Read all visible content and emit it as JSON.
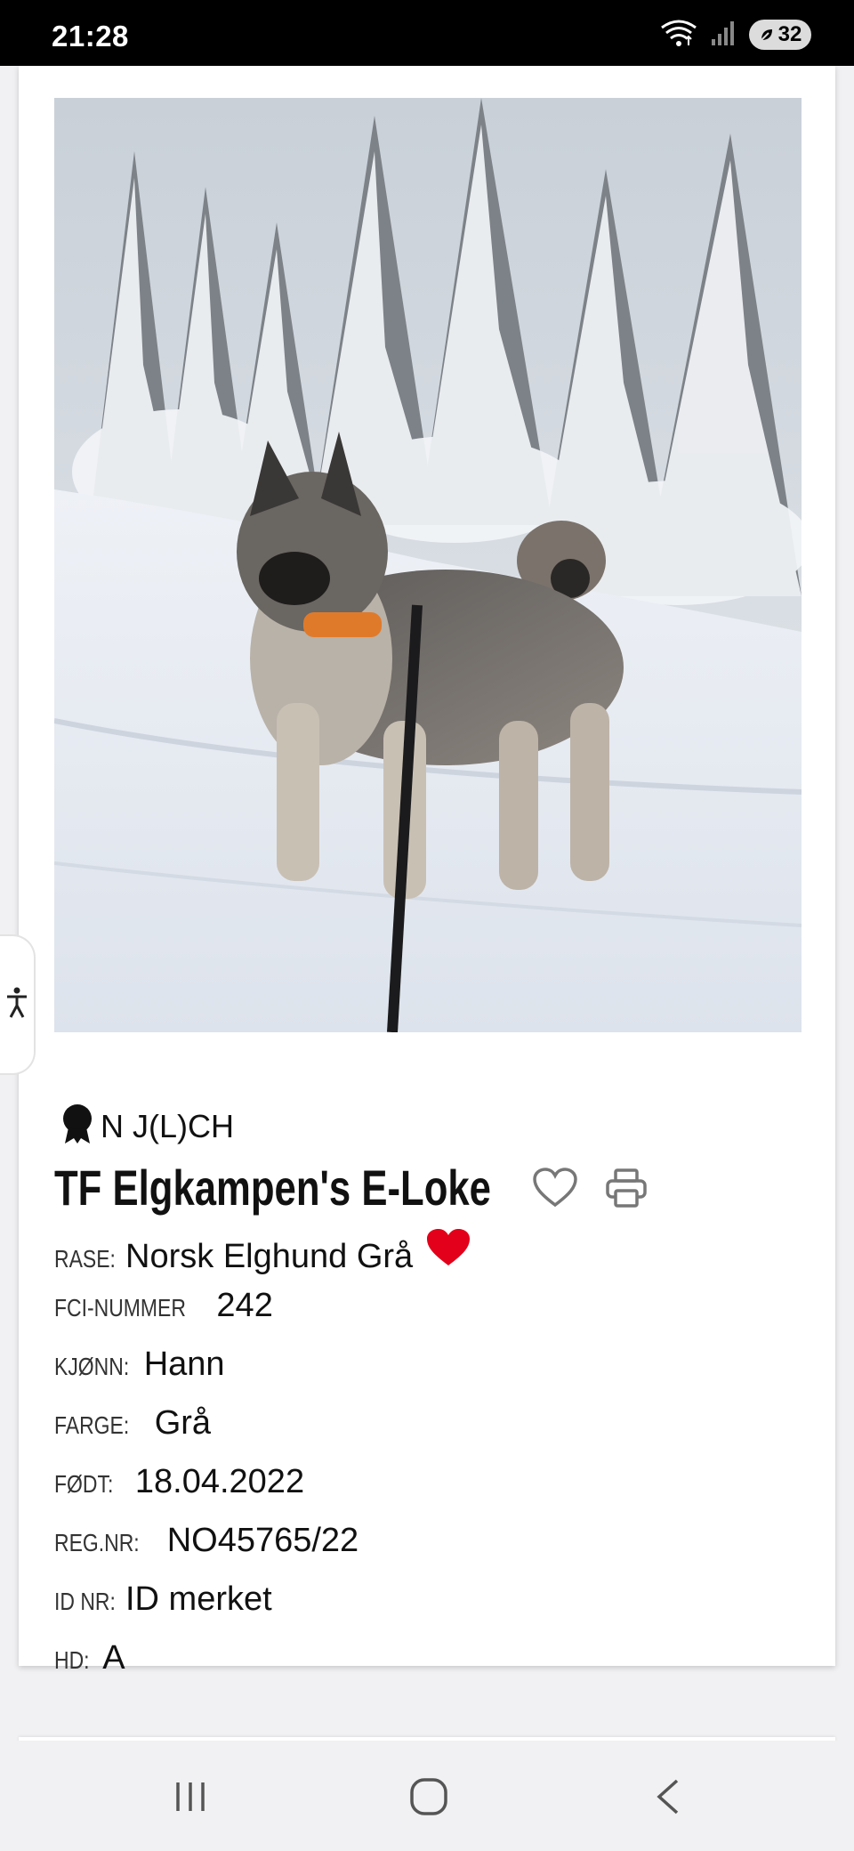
{
  "status_bar": {
    "time": "21:28",
    "battery": "32",
    "icons": [
      "wifi-icon",
      "signal-icon",
      "battery-saver-icon"
    ]
  },
  "dog": {
    "title_badge": "N J(L)CH",
    "name": "TF Elgkampen's E-Loke",
    "fields": [
      {
        "label": "RASE:",
        "value": "Norsk Elghund Grå"
      },
      {
        "label": "FCI-NUMMER",
        "value": "242"
      },
      {
        "label": "KJØNN:",
        "value": "Hann"
      },
      {
        "label": "FARGE:",
        "value": "Grå"
      },
      {
        "label": "FØDT:",
        "value": "18.04.2022"
      },
      {
        "label": "REG.NR:",
        "value": "NO45765/22"
      },
      {
        "label": "ID NR:",
        "value": "ID merket"
      },
      {
        "label": "HD:",
        "value": "A"
      }
    ]
  },
  "colors": {
    "accent_heart": "#e2001a",
    "status_bar_bg": "#000000",
    "page_bg": "#f1f1f3"
  },
  "icons": [
    "award-rosette-icon",
    "favorite-heart-outline-icon",
    "print-icon",
    "breed-heart-icon",
    "accessibility-icon"
  ],
  "nav": [
    "recent-apps-icon",
    "home-icon",
    "back-icon"
  ]
}
